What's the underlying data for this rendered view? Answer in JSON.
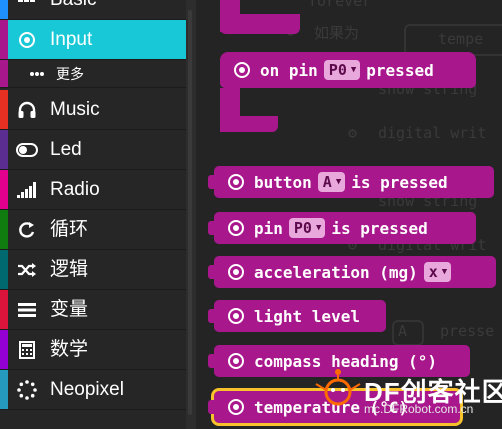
{
  "toolbox": {
    "categories": [
      {
        "label": "Basic",
        "icon": "grid-icon",
        "color": "#1e90ff"
      },
      {
        "label": "Input",
        "icon": "radio-target-icon",
        "color": "#a8188c",
        "selected": true
      },
      {
        "label": "更多",
        "icon": "more-dots-icon",
        "color": "#a8188c"
      },
      {
        "label": "Music",
        "icon": "headphones-icon",
        "color": "#e63022"
      },
      {
        "label": "Led",
        "icon": "toggle-icon",
        "color": "#5c2d91"
      },
      {
        "label": "Radio",
        "icon": "signal-bars-icon",
        "color": "#e3008c"
      },
      {
        "label": "循环",
        "icon": "refresh-icon",
        "color": "#107c10"
      },
      {
        "label": "逻辑",
        "icon": "shuffle-icon",
        "color": "#006970"
      },
      {
        "label": "变量",
        "icon": "lines-icon",
        "color": "#dc143c"
      },
      {
        "label": "数学",
        "icon": "calculator-icon",
        "color": "#9400d3"
      },
      {
        "label": "Neopixel",
        "icon": "ring-dots-icon",
        "color": "#2699bf"
      }
    ]
  },
  "workspace": {
    "ghost_texts": {
      "forever": "forever",
      "ruguowei": "如果为",
      "temp": "tempe",
      "show_string_1": "show string",
      "digital_write_1": "digital writ",
      "show_string_2": "show string",
      "digital_write_2": "digital writ",
      "ghost_a": "A",
      "pressed": "presse"
    },
    "blocks": {
      "on_pin": {
        "prefix": "on pin",
        "dropdown": "P0",
        "suffix": "pressed"
      },
      "button": {
        "prefix": "button",
        "dropdown": "A",
        "suffix": "is pressed"
      },
      "pin": {
        "prefix": "pin",
        "dropdown": "P0",
        "suffix": "is pressed"
      },
      "acceleration": {
        "prefix": "acceleration (mg)",
        "dropdown": "x"
      },
      "light": {
        "label": "light level"
      },
      "compass": {
        "label": "compass heading (°)"
      },
      "temperature": {
        "label": "temperature (°C)"
      }
    },
    "block_color": "#a8188c",
    "selected_outline": "#f7c22b"
  },
  "watermark": {
    "text": "DF创客社区",
    "url": "mc.DFRobot.com.cn"
  }
}
